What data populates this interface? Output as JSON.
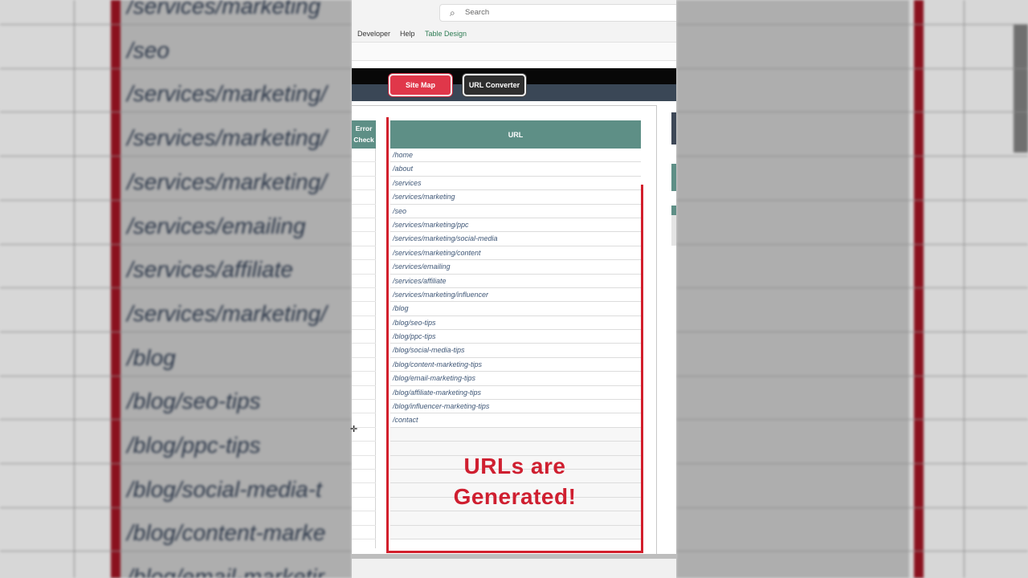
{
  "search": {
    "placeholder": "Search"
  },
  "menu": {
    "items": [
      "Developer",
      "Help",
      "Table Design"
    ]
  },
  "buttons": {
    "site_map": "Site Map",
    "url_converter": "URL Converter"
  },
  "table": {
    "error_header_line1": "Error",
    "error_header_line2": "Check",
    "url_header": "URL",
    "urls": [
      "/home",
      "/about",
      "/services",
      "/services/marketing",
      "/seo",
      "/services/marketing/ppc",
      "/services/marketing/social-media",
      "/services/marketing/content",
      "/services/emailing",
      "/services/affiliate",
      "/services/marketing/influencer",
      "/blog",
      "/blog/seo-tips",
      "/blog/ppc-tips",
      "/blog/social-media-tips",
      "/blog/content-marketing-tips",
      "/blog/email-marketing-tips",
      "/blog/affiliate-marketing-tips",
      "/blog/influencer-marketing-tips",
      "/contact"
    ],
    "empty_rows": 8
  },
  "overlay": {
    "line1": "URLs are",
    "line2": "Generated!"
  },
  "background": {
    "zoomed_urls": [
      "/services/marketing",
      "/seo",
      "/services/marketing/",
      "/services/marketing/",
      "/services/marketing/",
      "/services/emailing",
      "/services/affiliate",
      "/services/marketing/",
      "/blog",
      "/blog/seo-tips",
      "/blog/ppc-tips",
      "/blog/social-media-t",
      "/blog/content-marke",
      "/blog/email-marketir"
    ]
  },
  "colors": {
    "header_teal": "#5e8f86",
    "site_map_red": "#e0374a",
    "highlight_red": "#d21f2c",
    "url_text": "#3e5676"
  },
  "icons": [
    "search-icon",
    "cursor-icon"
  ]
}
